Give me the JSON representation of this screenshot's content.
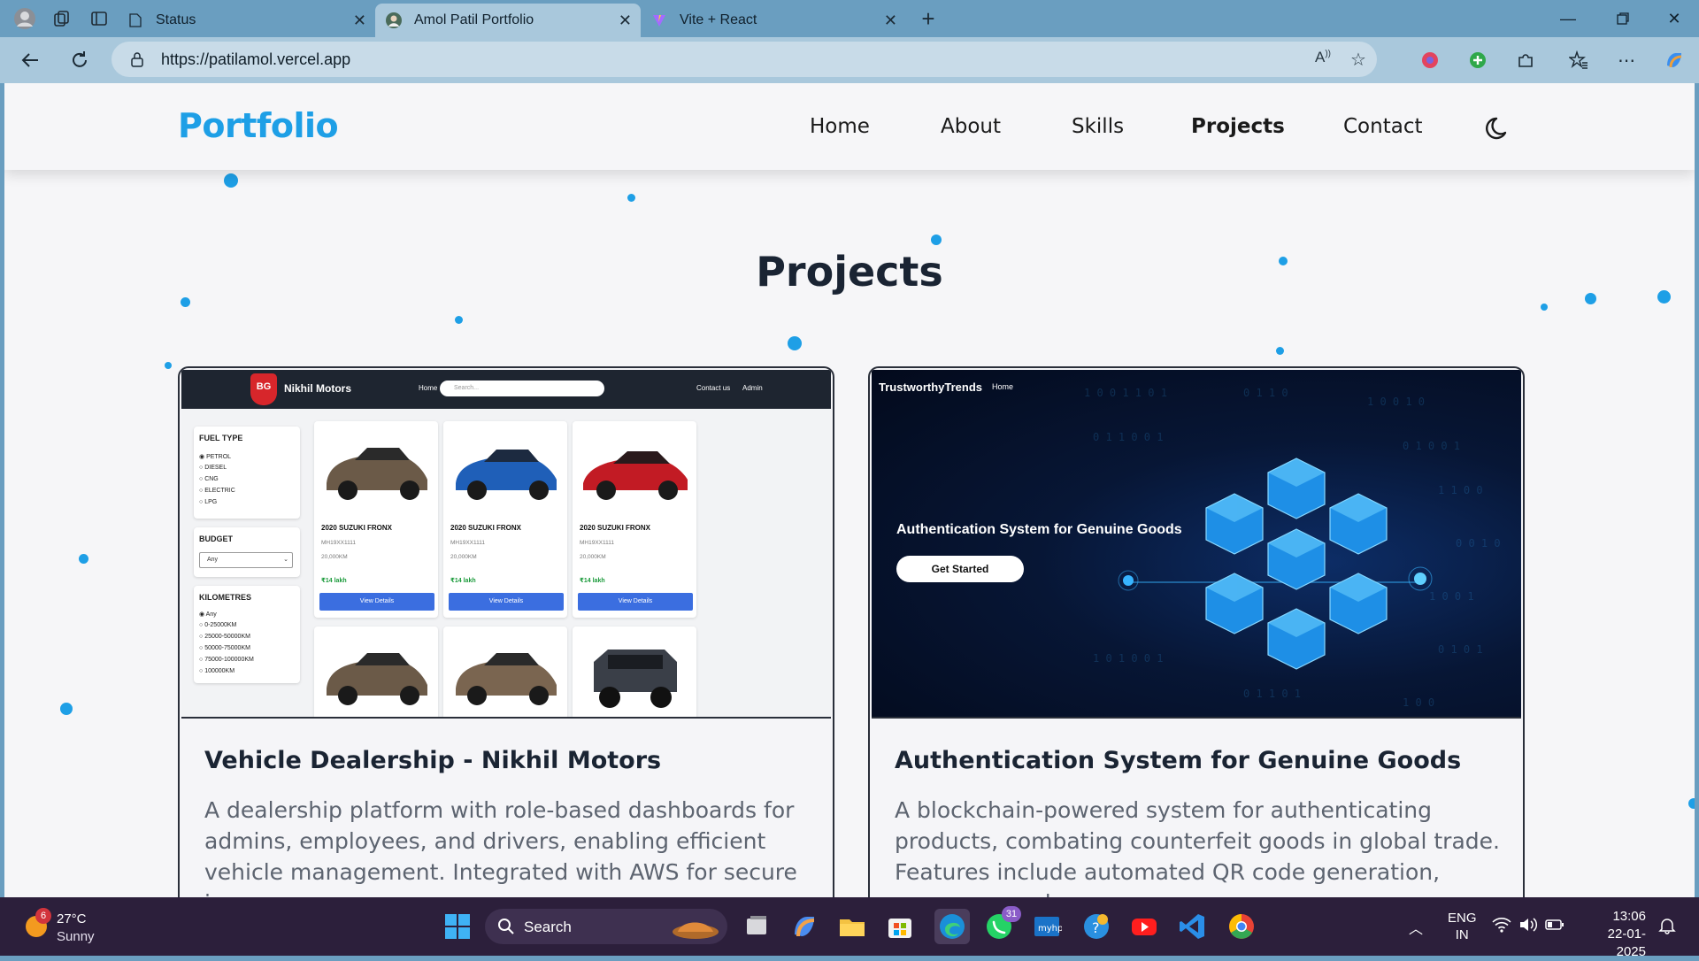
{
  "browser": {
    "tabs": [
      {
        "label": "Status",
        "icon": "page-icon",
        "active": false
      },
      {
        "label": "Amol Patil Portfolio",
        "icon": "avatar-icon",
        "active": true
      },
      {
        "label": "Vite + React",
        "icon": "vite-icon",
        "active": false
      }
    ],
    "url": "https://patilamol.vercel.app"
  },
  "site": {
    "logo": "Portfolio",
    "nav": [
      {
        "label": "Home",
        "active": false
      },
      {
        "label": "About",
        "active": false
      },
      {
        "label": "Skills",
        "active": false
      },
      {
        "label": "Projects",
        "active": true
      },
      {
        "label": "Contact",
        "active": false
      }
    ],
    "theme_toggle_icon": "moon-icon",
    "accent_color": "#1e9fe6",
    "section_title": "Projects",
    "projects": [
      {
        "title": "Vehicle Dealership - Nikhil Motors",
        "description": "A dealership platform with role-based dashboards for admins, employees, and drivers, enabling efficient vehicle management. Integrated with AWS for secure image",
        "preview": {
          "brand_badge": "BG",
          "brand": "Nikhil Motors",
          "home": "Home",
          "search_placeholder": "Search...",
          "contact": "Contact us",
          "admin": "Admin",
          "fuel_heading": "FUEL TYPE",
          "fuel_options": [
            "PETROL",
            "DIESEL",
            "CNG",
            "ELECTRIC",
            "LPG"
          ],
          "budget_heading": "BUDGET",
          "budget_value": "Any",
          "km_heading": "KILOMETRES",
          "km_options": [
            "Any",
            "0-25000KM",
            "25000-50000KM",
            "50000-75000KM",
            "75000-100000KM",
            "100000KM"
          ],
          "cars": [
            {
              "title": "2020 SUZUKI FRONX",
              "reg": "MH19XX1111",
              "km": "20,000KM",
              "price": "₹14 lakh",
              "button": "View Details",
              "color": "#6b5a48"
            },
            {
              "title": "2020 SUZUKI FRONX",
              "reg": "MH19XX1111",
              "km": "20,000KM",
              "price": "₹14 lakh",
              "button": "View Details",
              "color": "#1f5fb8"
            },
            {
              "title": "2020 SUZUKI FRONX",
              "reg": "MH19XX1111",
              "km": "20,000KM",
              "price": "₹14 lakh",
              "button": "View Details",
              "color": "#c21b24"
            }
          ],
          "cars_row2_colors": [
            "#6b5a48",
            "#7a6550",
            "#3a3f48"
          ]
        }
      },
      {
        "title": "Authentication System for Genuine Goods",
        "description": "A blockchain-powered system for authenticating products, combating counterfeit goods in global trade. Features include automated QR code generation, consumer code",
        "preview": {
          "brand": "TrustworthyTrends",
          "home": "Home",
          "hero": "Authentication System for Genuine Goods",
          "button": "Get Started"
        }
      }
    ]
  },
  "taskbar": {
    "weather_temp": "27°C",
    "weather_desc": "Sunny",
    "weather_badge": "6",
    "search_label": "Search",
    "whatsapp_badge": "31",
    "lang_line1": "ENG",
    "lang_line2": "IN",
    "time": "13:06",
    "date": "22-01-2025"
  }
}
